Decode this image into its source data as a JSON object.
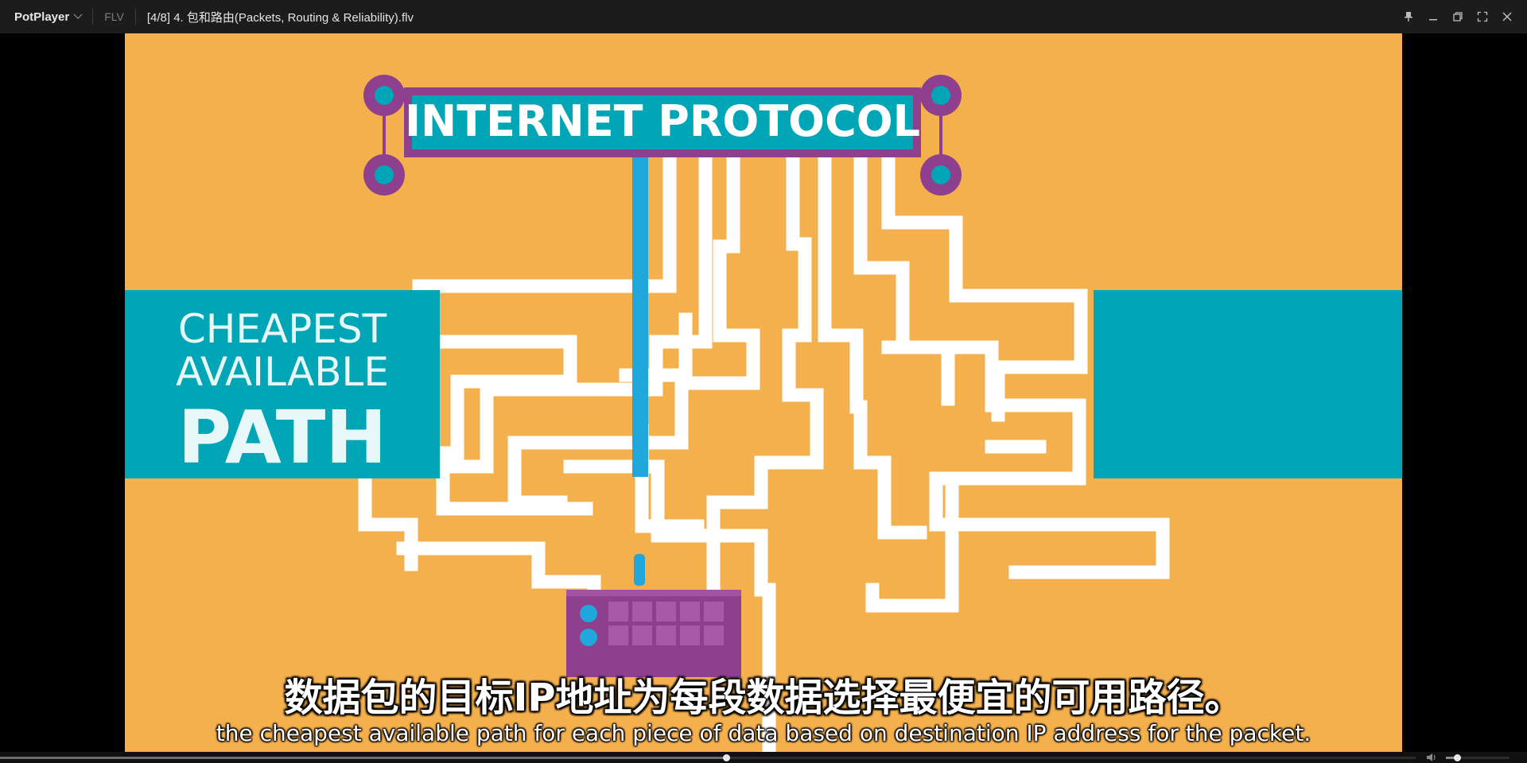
{
  "titlebar": {
    "app_name": "PotPlayer",
    "format": "FLV",
    "file_title": "[4/8] 4. 包和路由(Packets, Routing & Reliability).flv",
    "controls": [
      "pin-icon",
      "minimize-icon",
      "restore-icon",
      "fullscreen-icon",
      "close-icon"
    ]
  },
  "video": {
    "banner_text": "INTERNET PROTOCOL",
    "left_panel": {
      "line1": "CHEAPEST",
      "line2": "AVAILABLE",
      "line3": "PATH"
    },
    "colors": {
      "background": "#F5B04E",
      "teal": "#00A6B5",
      "purple": "#8E3F8E",
      "maze": "#FFFFFF",
      "path": "#22A7DC"
    }
  },
  "subtitles": {
    "chinese": "数据包的目标IP地址为每段数据选择最便宜的可用路径。",
    "english": "the cheapest available path for each piece of data based on destination IP address for the packet."
  },
  "playback": {
    "progress": 0.513,
    "volume": 0.18
  }
}
